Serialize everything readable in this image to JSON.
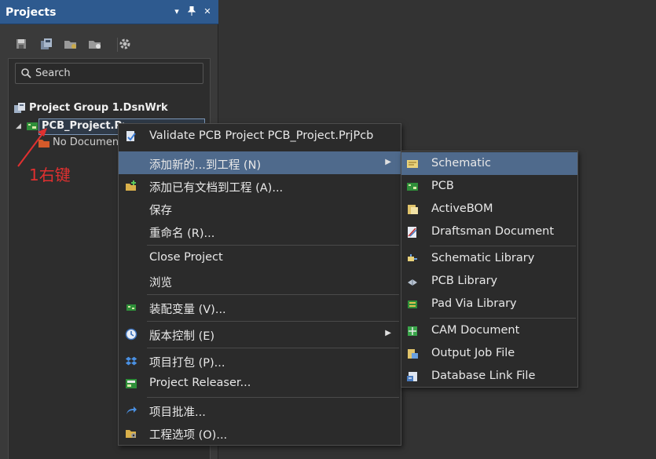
{
  "panel": {
    "title": "Projects",
    "header_buttons": [
      "▾",
      "📌",
      "✕"
    ],
    "search_placeholder": "Search"
  },
  "tree": {
    "group": "Project Group 1.DsnWrk",
    "project": "PCB_Project.PrjPcb",
    "project_visible": "PCB_Project.PrjPcb",
    "child": "No Documents"
  },
  "annotation": {
    "text": "1右键",
    "color": "#e03030"
  },
  "context_menu": {
    "items": [
      {
        "label": "Validate PCB Project PCB_Project.PrjPcb",
        "icon": "validate-icon"
      },
      {
        "label": "添加新的...到工程 (N)",
        "icon": "",
        "submenu": true,
        "highlighted": true
      },
      {
        "label": "添加已有文档到工程 (A)...",
        "icon": "add-existing-icon"
      },
      {
        "label": "保存",
        "icon": ""
      },
      {
        "label": "重命名 (R)...",
        "icon": ""
      },
      {
        "label": "Close Project",
        "icon": ""
      },
      {
        "label": "浏览",
        "icon": ""
      },
      {
        "label": "装配变量 (V)...",
        "icon": "variants-icon"
      },
      {
        "label": "版本控制 (E)",
        "icon": "clock-icon",
        "submenu": true
      },
      {
        "label": "项目打包 (P)...",
        "icon": "dropbox-icon"
      },
      {
        "label": "Project Releaser...",
        "icon": "releaser-icon"
      },
      {
        "label": "项目批准...",
        "icon": "share-arrow-icon"
      },
      {
        "label": "工程选项 (O)...",
        "icon": "options-icon"
      }
    ]
  },
  "submenu": {
    "items": [
      {
        "label": "Schematic",
        "icon": "schematic-icon",
        "highlighted": true
      },
      {
        "label": "PCB",
        "icon": "pcb-icon"
      },
      {
        "label": "ActiveBOM",
        "icon": "bom-icon"
      },
      {
        "label": "Draftsman Document",
        "icon": "draftsman-icon"
      },
      {
        "label": "Schematic Library",
        "icon": "schlib-icon"
      },
      {
        "label": "PCB Library",
        "icon": "pcblib-icon"
      },
      {
        "label": "Pad Via Library",
        "icon": "padvia-icon"
      },
      {
        "label": "CAM Document",
        "icon": "cam-icon"
      },
      {
        "label": "Output Job File",
        "icon": "outjob-icon"
      },
      {
        "label": "Database Link File",
        "icon": "dblink-icon"
      }
    ]
  },
  "colors": {
    "header": "#2e5a8f",
    "highlight": "#4f6a8c",
    "background": "#333333"
  }
}
